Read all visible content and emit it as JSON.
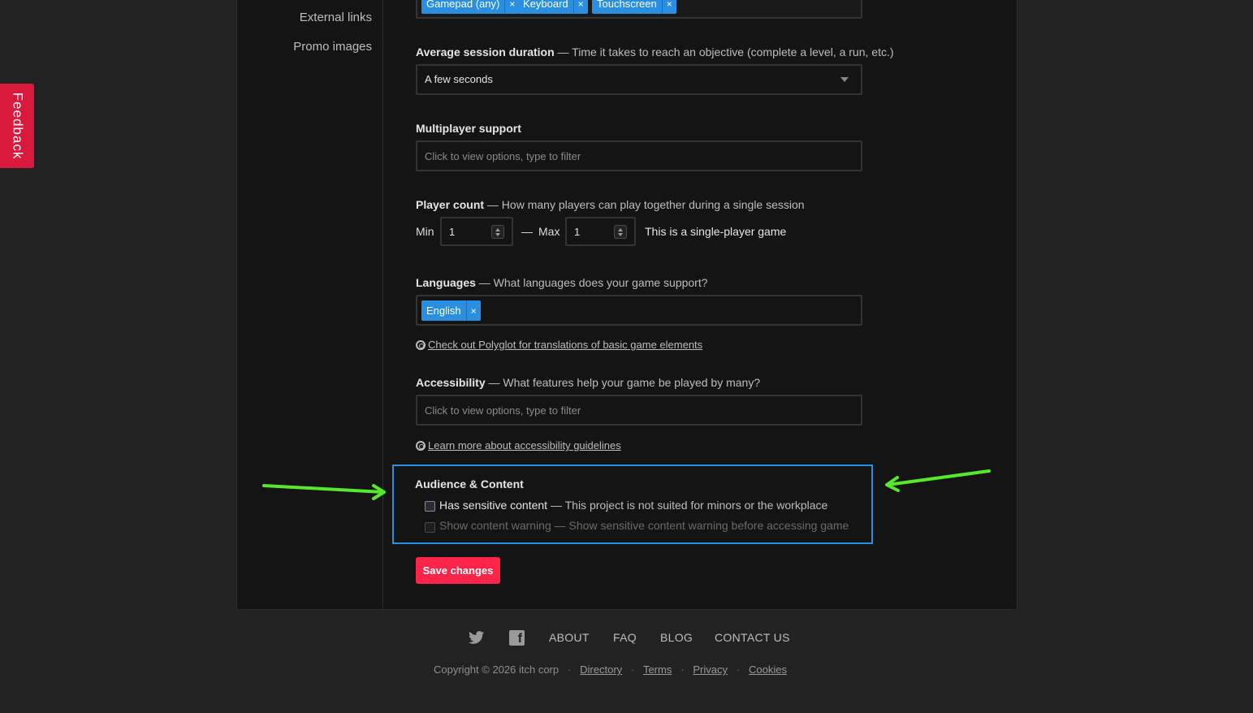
{
  "feedback_tab": "Feedback",
  "sidebar": {
    "items": [
      {
        "label": "External links"
      },
      {
        "label": "Promo images"
      }
    ]
  },
  "input_methods": {
    "tags": [
      "Gamepad (any)",
      "Keyboard",
      "Touchscreen"
    ],
    "remove_glyph": "×"
  },
  "session_duration": {
    "label": "Average session duration",
    "hint": "— Time it takes to reach an objective (complete a level, a run, etc.)",
    "value": "A few seconds"
  },
  "multiplayer": {
    "label": "Multiplayer support",
    "placeholder": "Click to view options, type to filter"
  },
  "player_count": {
    "label": "Player count",
    "hint": "— How many players can play together during a single session",
    "min_label": "Min",
    "min_value": "1",
    "dash": "—",
    "max_label": "Max",
    "max_value": "1",
    "status": "This is a single-player game"
  },
  "languages": {
    "label": "Languages",
    "hint": "— What languages does your game support?",
    "tags": [
      "English"
    ],
    "help_link": "Check out Polyglot for translations of basic game elements"
  },
  "accessibility": {
    "label": "Accessibility",
    "hint": "— What features help your game be played by many?",
    "placeholder": "Click to view options, type to filter",
    "help_link": "Learn more about accessibility guidelines"
  },
  "audience": {
    "title": "Audience & Content",
    "sensitive_label": "Has sensitive content",
    "sensitive_hint": "— This project is not suited for minors or the workplace",
    "warning_label": "Show content warning",
    "warning_hint": "— Show sensitive content warning before accessing game"
  },
  "save_button": "Save changes",
  "footer": {
    "nav": [
      "ABOUT",
      "FAQ",
      "BLOG",
      "CONTACT US"
    ],
    "copyright": "Copyright © 2026 itch corp",
    "links": [
      "Directory",
      "Terms",
      "Privacy",
      "Cookies"
    ],
    "separator": "·"
  },
  "colors": {
    "accent_blue": "#2a8fe0",
    "save_red": "#ff2449",
    "feedback_red": "#da1a3c",
    "arrow_green": "#56e82a"
  },
  "icons": [
    "twitter-icon",
    "facebook-icon",
    "lifebuoy-icon",
    "chevron-down-icon",
    "green-arrow-annotation"
  ]
}
